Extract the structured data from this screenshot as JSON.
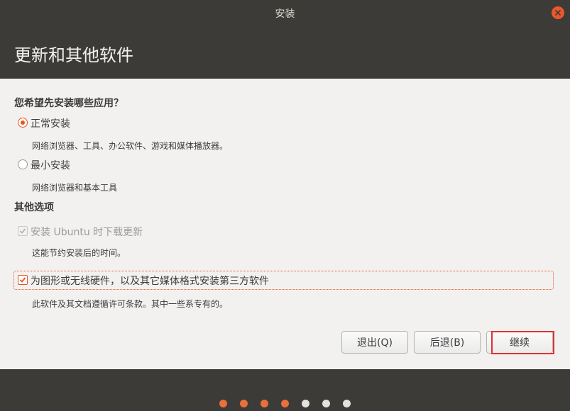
{
  "window": {
    "title": "安装",
    "page_title": "更新和其他软件"
  },
  "colors": {
    "accent": "#e95420",
    "header_bg": "#3c3b37",
    "content_bg": "#f2f1f0",
    "highlight_border": "#e03232"
  },
  "install_type": {
    "question": "您希望先安装哪些应用？",
    "options": [
      {
        "label": "正常安装",
        "description": "网络浏览器、工具、办公软件、游戏和媒体播放器。",
        "selected": true
      },
      {
        "label": "最小安装",
        "description": "网络浏览器和基本工具",
        "selected": false
      }
    ]
  },
  "other_options": {
    "heading": "其他选项",
    "download_updates": {
      "label": "安装 Ubuntu 时下载更新",
      "description": "这能节约安装后的时间。",
      "checked": true,
      "enabled": false
    },
    "third_party": {
      "label": "为图形或无线硬件，以及其它媒体格式安装第三方软件",
      "description": "此软件及其文档遵循许可条款。其中一些系专有的。",
      "checked": true,
      "enabled": true
    }
  },
  "buttons": {
    "quit": "退出(Q)",
    "back": "后退(B)",
    "continue": "继续"
  },
  "progress": {
    "total_steps": 7,
    "completed_steps": 4
  },
  "icons": {
    "close": "close-icon",
    "check": "checkmark-icon"
  }
}
